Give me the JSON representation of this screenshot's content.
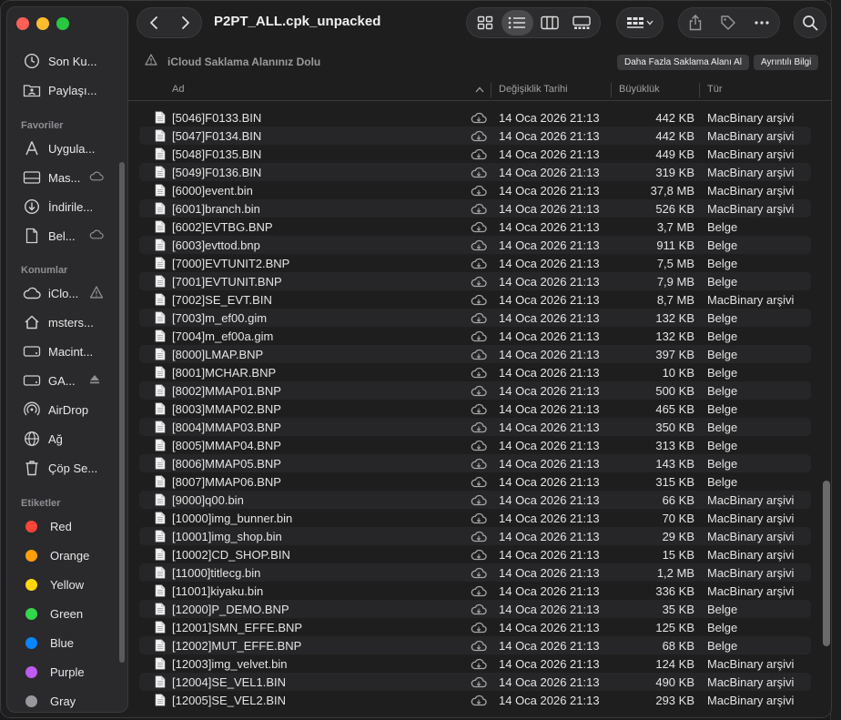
{
  "window": {
    "title": "P2PT_ALL.cpk_unpacked"
  },
  "sidebar": {
    "top_items": [
      {
        "label": "Son Ku...",
        "icon": "clock-icon"
      },
      {
        "label": "Paylaşı...",
        "icon": "shared-folder-icon"
      }
    ],
    "favorites_title": "Favoriler",
    "favorites": [
      {
        "label": "Uygula...",
        "icon": "applications-icon",
        "trailing": ""
      },
      {
        "label": "Mas...",
        "icon": "desktop-icon",
        "trailing": "cloud"
      },
      {
        "label": "İndirile...",
        "icon": "downloads-icon",
        "trailing": ""
      },
      {
        "label": "Bel...",
        "icon": "document-icon",
        "trailing": "cloud"
      }
    ],
    "locations_title": "Konumlar",
    "locations": [
      {
        "label": "iClo...",
        "icon": "icloud-icon",
        "trailing": "warning"
      },
      {
        "label": "msters...",
        "icon": "home-icon",
        "trailing": ""
      },
      {
        "label": "Macint...",
        "icon": "disk-icon",
        "trailing": ""
      },
      {
        "label": "GA...",
        "icon": "disk-icon",
        "trailing": "eject"
      },
      {
        "label": "AirDrop",
        "icon": "airdrop-icon",
        "trailing": ""
      },
      {
        "label": "Ağ",
        "icon": "network-icon",
        "trailing": ""
      },
      {
        "label": "Çöp Se...",
        "icon": "trash-icon",
        "trailing": ""
      }
    ],
    "tags_title": "Etiketler",
    "tags": [
      {
        "label": "Red",
        "color": "#ff453a"
      },
      {
        "label": "Orange",
        "color": "#ff9f0a"
      },
      {
        "label": "Yellow",
        "color": "#ffd60a"
      },
      {
        "label": "Green",
        "color": "#32d74b"
      },
      {
        "label": "Blue",
        "color": "#0a84ff"
      },
      {
        "label": "Purple",
        "color": "#bf5af2"
      },
      {
        "label": "Gray",
        "color": "#98989d"
      }
    ]
  },
  "banner": {
    "message": "iCloud Saklama Alanınız Dolu",
    "button_more": "Daha Fazla Saklama Alanı Al",
    "button_details": "Ayrıntılı Bilgi"
  },
  "columns": {
    "name": "Ad",
    "date": "Değişiklik Tarihi",
    "size": "Büyüklük",
    "kind": "Tür"
  },
  "files": [
    {
      "name": "[5046]F0133.BIN",
      "date": "14 Oca 2026 21:13",
      "size": "442 KB",
      "kind": "MacBinary arşivi"
    },
    {
      "name": "[5047]F0134.BIN",
      "date": "14 Oca 2026 21:13",
      "size": "442 KB",
      "kind": "MacBinary arşivi"
    },
    {
      "name": "[5048]F0135.BIN",
      "date": "14 Oca 2026 21:13",
      "size": "449 KB",
      "kind": "MacBinary arşivi"
    },
    {
      "name": "[5049]F0136.BIN",
      "date": "14 Oca 2026 21:13",
      "size": "319 KB",
      "kind": "MacBinary arşivi"
    },
    {
      "name": "[6000]event.bin",
      "date": "14 Oca 2026 21:13",
      "size": "37,8 MB",
      "kind": "MacBinary arşivi"
    },
    {
      "name": "[6001]branch.bin",
      "date": "14 Oca 2026 21:13",
      "size": "526 KB",
      "kind": "MacBinary arşivi"
    },
    {
      "name": "[6002]EVTBG.BNP",
      "date": "14 Oca 2026 21:13",
      "size": "3,7 MB",
      "kind": "Belge"
    },
    {
      "name": "[6003]evttod.bnp",
      "date": "14 Oca 2026 21:13",
      "size": "911 KB",
      "kind": "Belge"
    },
    {
      "name": "[7000]EVTUNIT2.BNP",
      "date": "14 Oca 2026 21:13",
      "size": "7,5 MB",
      "kind": "Belge"
    },
    {
      "name": "[7001]EVTUNIT.BNP",
      "date": "14 Oca 2026 21:13",
      "size": "7,9 MB",
      "kind": "Belge"
    },
    {
      "name": "[7002]SE_EVT.BIN",
      "date": "14 Oca 2026 21:13",
      "size": "8,7 MB",
      "kind": "MacBinary arşivi"
    },
    {
      "name": "[7003]m_ef00.gim",
      "date": "14 Oca 2026 21:13",
      "size": "132 KB",
      "kind": "Belge"
    },
    {
      "name": "[7004]m_ef00a.gim",
      "date": "14 Oca 2026 21:13",
      "size": "132 KB",
      "kind": "Belge"
    },
    {
      "name": "[8000]LMAP.BNP",
      "date": "14 Oca 2026 21:13",
      "size": "397 KB",
      "kind": "Belge"
    },
    {
      "name": "[8001]MCHAR.BNP",
      "date": "14 Oca 2026 21:13",
      "size": "10 KB",
      "kind": "Belge"
    },
    {
      "name": "[8002]MMAP01.BNP",
      "date": "14 Oca 2026 21:13",
      "size": "500 KB",
      "kind": "Belge"
    },
    {
      "name": "[8003]MMAP02.BNP",
      "date": "14 Oca 2026 21:13",
      "size": "465 KB",
      "kind": "Belge"
    },
    {
      "name": "[8004]MMAP03.BNP",
      "date": "14 Oca 2026 21:13",
      "size": "350 KB",
      "kind": "Belge"
    },
    {
      "name": "[8005]MMAP04.BNP",
      "date": "14 Oca 2026 21:13",
      "size": "313 KB",
      "kind": "Belge"
    },
    {
      "name": "[8006]MMAP05.BNP",
      "date": "14 Oca 2026 21:13",
      "size": "143 KB",
      "kind": "Belge"
    },
    {
      "name": "[8007]MMAP06.BNP",
      "date": "14 Oca 2026 21:13",
      "size": "315 KB",
      "kind": "Belge"
    },
    {
      "name": "[9000]q00.bin",
      "date": "14 Oca 2026 21:13",
      "size": "66 KB",
      "kind": "MacBinary arşivi"
    },
    {
      "name": "[10000]img_bunner.bin",
      "date": "14 Oca 2026 21:13",
      "size": "70 KB",
      "kind": "MacBinary arşivi"
    },
    {
      "name": "[10001]img_shop.bin",
      "date": "14 Oca 2026 21:13",
      "size": "29 KB",
      "kind": "MacBinary arşivi"
    },
    {
      "name": "[10002]CD_SHOP.BIN",
      "date": "14 Oca 2026 21:13",
      "size": "15 KB",
      "kind": "MacBinary arşivi"
    },
    {
      "name": "[11000]titlecg.bin",
      "date": "14 Oca 2026 21:13",
      "size": "1,2 MB",
      "kind": "MacBinary arşivi"
    },
    {
      "name": "[11001]kiyaku.bin",
      "date": "14 Oca 2026 21:13",
      "size": "336 KB",
      "kind": "MacBinary arşivi"
    },
    {
      "name": "[12000]P_DEMO.BNP",
      "date": "14 Oca 2026 21:13",
      "size": "35 KB",
      "kind": "Belge"
    },
    {
      "name": "[12001]SMN_EFFE.BNP",
      "date": "14 Oca 2026 21:13",
      "size": "125 KB",
      "kind": "Belge"
    },
    {
      "name": "[12002]MUT_EFFE.BNP",
      "date": "14 Oca 2026 21:13",
      "size": "68 KB",
      "kind": "Belge"
    },
    {
      "name": "[12003]img_velvet.bin",
      "date": "14 Oca 2026 21:13",
      "size": "124 KB",
      "kind": "MacBinary arşivi"
    },
    {
      "name": "[12004]SE_VEL1.BIN",
      "date": "14 Oca 2026 21:13",
      "size": "490 KB",
      "kind": "MacBinary arşivi"
    },
    {
      "name": "[12005]SE_VEL2.BIN",
      "date": "14 Oca 2026 21:13",
      "size": "293 KB",
      "kind": "MacBinary arşivi"
    }
  ]
}
